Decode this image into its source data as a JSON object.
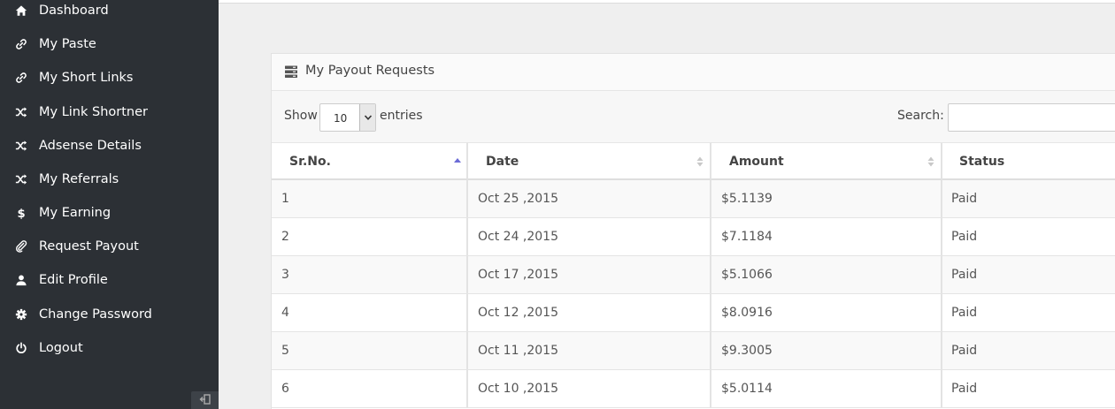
{
  "sidebar": {
    "items": [
      {
        "label": "Dashboard",
        "icon": "home-icon"
      },
      {
        "label": "My Paste",
        "icon": "link-icon"
      },
      {
        "label": "My Short Links",
        "icon": "link-icon"
      },
      {
        "label": "My Link Shortner",
        "icon": "shuffle-icon"
      },
      {
        "label": "Adsense Details",
        "icon": "shuffle-icon"
      },
      {
        "label": "My Referrals",
        "icon": "shuffle-icon"
      },
      {
        "label": "My Earning",
        "icon": "dollar-icon"
      },
      {
        "label": "Request Payout",
        "icon": "paperclip-icon"
      },
      {
        "label": "Edit Profile",
        "icon": "user-icon"
      },
      {
        "label": "Change Password",
        "icon": "gear-icon"
      },
      {
        "label": "Logout",
        "icon": "power-icon"
      }
    ]
  },
  "panel": {
    "title": "My Payout Requests",
    "show_label": "Show",
    "page_length": "10",
    "entries_label": "entries",
    "search_label": "Search:",
    "search_value": ""
  },
  "table": {
    "columns": [
      "Sr.No.",
      "Date",
      "Amount",
      "Status"
    ],
    "rows": [
      [
        "1",
        "Oct 25 ,2015",
        "$5.1139",
        "Paid"
      ],
      [
        "2",
        "Oct 24 ,2015",
        "$7.1184",
        "Paid"
      ],
      [
        "3",
        "Oct 17 ,2015",
        "$5.1066",
        "Paid"
      ],
      [
        "4",
        "Oct 12 ,2015",
        "$8.0916",
        "Paid"
      ],
      [
        "5",
        "Oct 11 ,2015",
        "$9.3005",
        "Paid"
      ],
      [
        "6",
        "Oct 10 ,2015",
        "$5.0114",
        "Paid"
      ]
    ]
  },
  "colors": {
    "sidebar_bg": "#2c3035",
    "sort_active": "#6b6bd6",
    "sort_inactive": "#c8c8c8"
  }
}
